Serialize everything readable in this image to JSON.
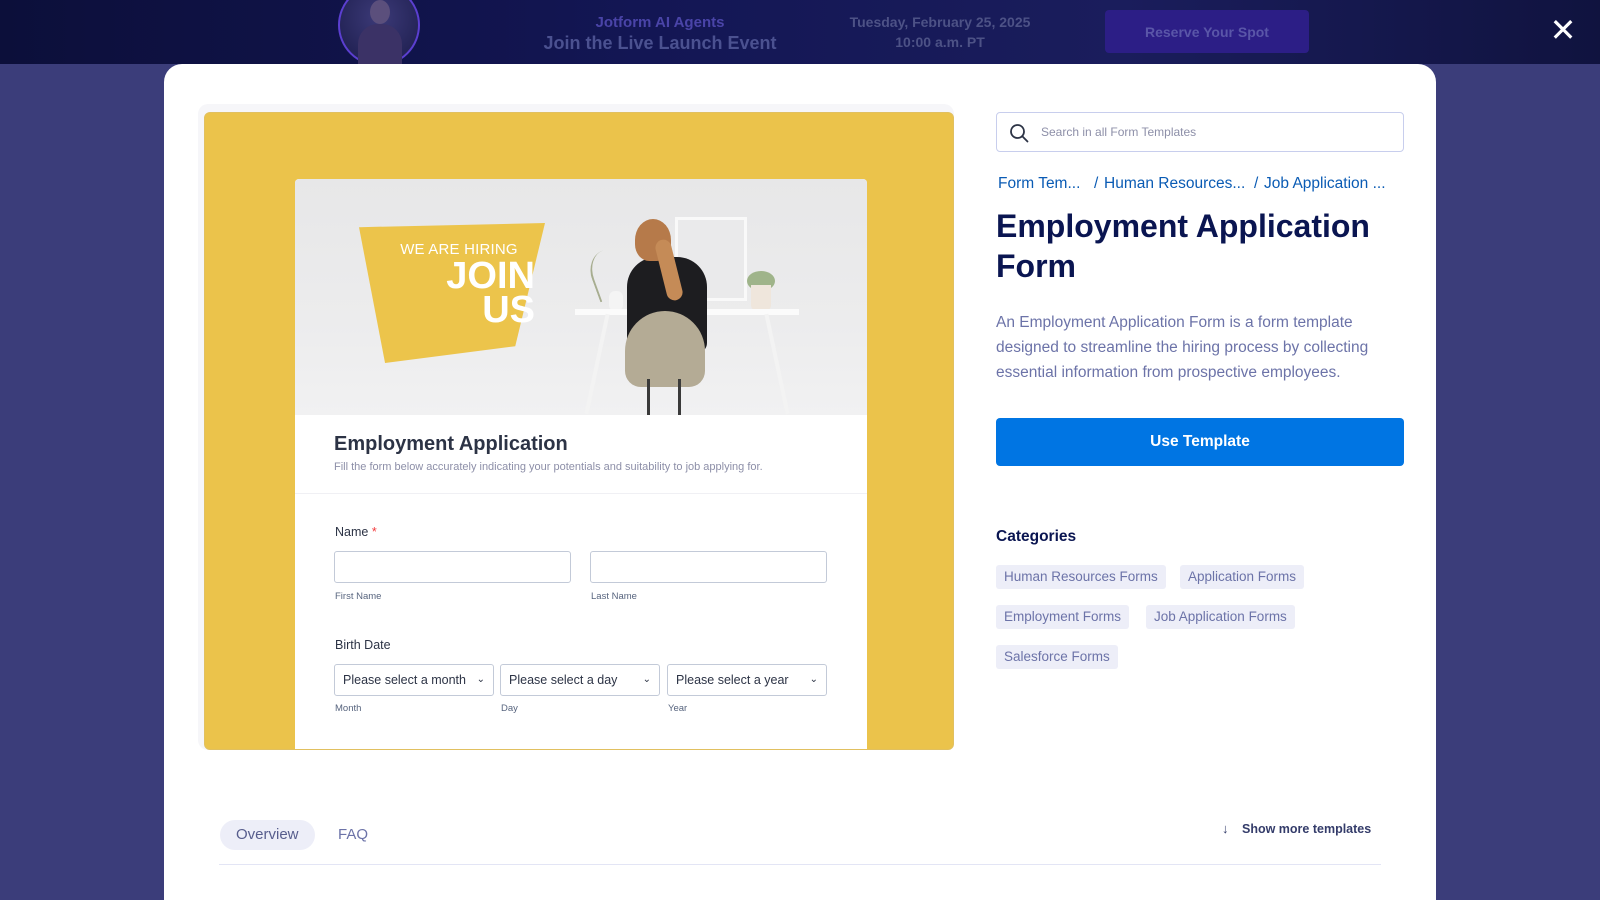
{
  "banner": {
    "brand": "Jotform AI Agents",
    "event": "Join the Live Launch Event",
    "date_line1": "Tuesday, February 25, 2025",
    "date_line2": "10:00 a.m. PT",
    "cta_label": "Reserve Your Spot"
  },
  "overlay": {
    "close_glyph": "✕"
  },
  "preview": {
    "badge_small": "WE ARE HIRING",
    "badge_line1": "JOIN",
    "badge_line2": "US",
    "form_title": "Employment Application",
    "form_subtitle": "Fill the form below accurately indicating your potentials and suitability to job applying for.",
    "name_label": "Name",
    "required_mark": "*",
    "first_name_sublabel": "First Name",
    "last_name_sublabel": "Last Name",
    "birth_label": "Birth Date",
    "month_value": "Please select a month",
    "day_value": "Please select a day",
    "year_value": "Please select a year",
    "month_sublabel": "Month",
    "day_sublabel": "Day",
    "year_sublabel": "Year"
  },
  "search": {
    "placeholder": "Search in all Form Templates"
  },
  "breadcrumb": {
    "items": [
      "Form Templates",
      "Human Resources Forms",
      "Job Application Forms"
    ],
    "display": [
      "Form Tem...",
      "Human Resources...",
      "Job Application ..."
    ],
    "separator": "/"
  },
  "template": {
    "title": "Employment Application Form",
    "description": "An Employment Application Form is a form template designed to streamline the hiring process by collecting essential information from prospective employees.",
    "use_label": "Use Template"
  },
  "categories": {
    "title": "Categories",
    "items": [
      "Human Resources Forms",
      "Application Forms",
      "Employment Forms",
      "Job Application Forms",
      "Salesforce Forms"
    ]
  },
  "tabs": {
    "overview": "Overview",
    "faq": "FAQ"
  },
  "show_more": {
    "label": "Show more templates"
  },
  "colors": {
    "primary": "#0075e3",
    "title": "#0a1551",
    "preview_bg": "#ebc34b",
    "chip_bg": "#edeef8"
  }
}
